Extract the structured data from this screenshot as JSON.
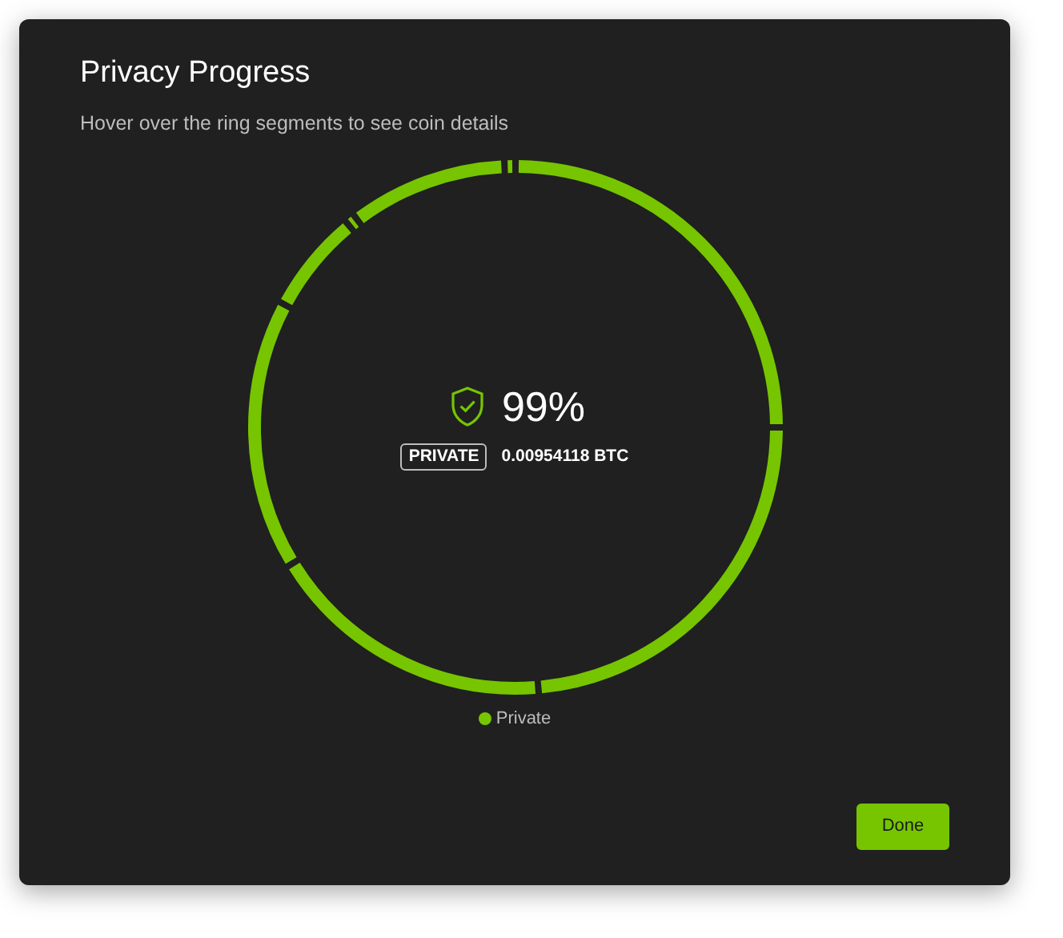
{
  "dialog": {
    "title": "Privacy Progress",
    "subtitle": "Hover over the ring segments to see coin details"
  },
  "center": {
    "percent": "99%",
    "badge": "PRIVATE",
    "amount": "0.00954118 BTC"
  },
  "legend": [
    {
      "label": "Private",
      "color": "#76c500"
    }
  ],
  "buttons": [
    {
      "label": "Done"
    }
  ]
}
